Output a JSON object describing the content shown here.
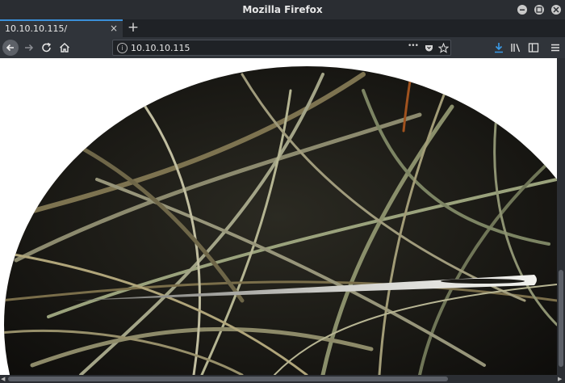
{
  "window": {
    "title": "Mozilla Firefox"
  },
  "tab": {
    "label": "10.10.10.115/",
    "close": "×"
  },
  "new_tab": "+",
  "urlbar": {
    "url": "10.10.10.115",
    "info": "i",
    "more": "•••"
  },
  "content": {
    "image": "haystack-needle-photo"
  }
}
